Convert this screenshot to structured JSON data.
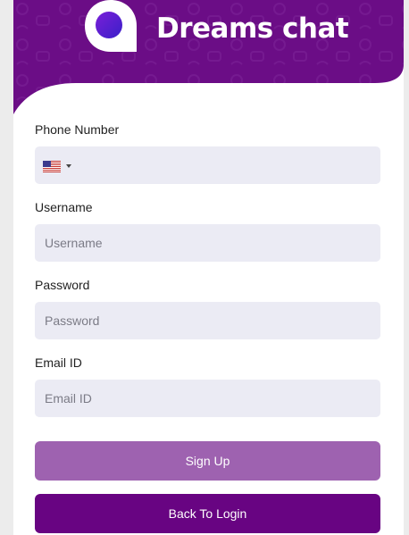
{
  "brand": {
    "name": "Dreams chat",
    "colors": {
      "header": "#6b0d86",
      "primary": "#680482",
      "primary_light": "#9e62b0",
      "input_bg": "#ebebf4"
    }
  },
  "form": {
    "phone": {
      "label": "Phone Number",
      "value": "",
      "country_icon": "us-flag-icon"
    },
    "username": {
      "label": "Username",
      "placeholder": "Username",
      "value": ""
    },
    "password": {
      "label": "Password",
      "placeholder": "Password",
      "value": ""
    },
    "email": {
      "label": "Email ID",
      "placeholder": "Email ID",
      "value": ""
    }
  },
  "buttons": {
    "signup": "Sign Up",
    "back_to_login": "Back To Login"
  }
}
